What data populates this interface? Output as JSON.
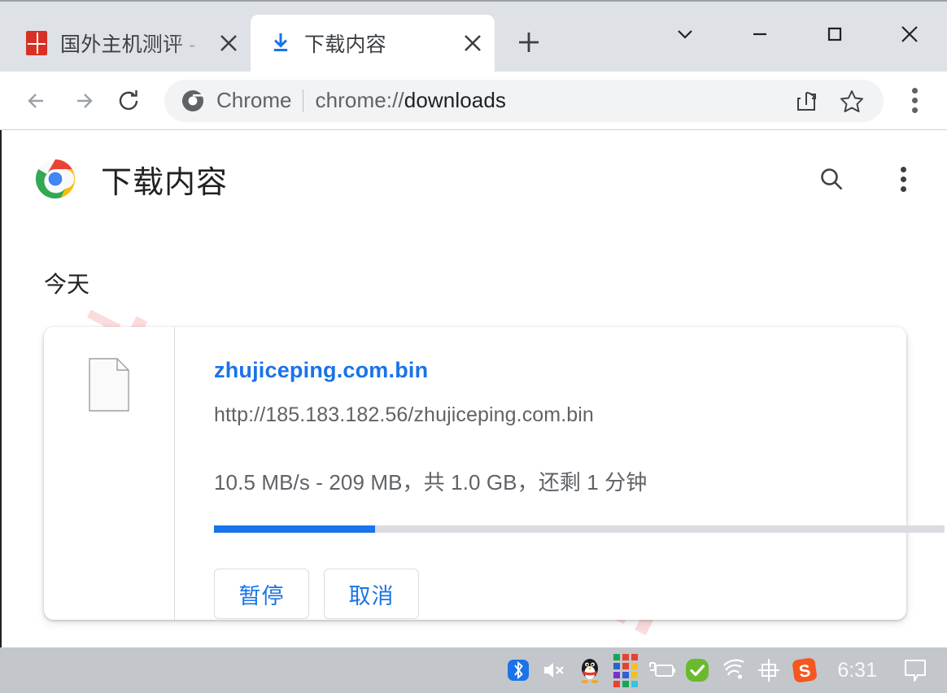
{
  "browser": {
    "tabs": [
      {
        "title": "国外主机测评 - 国",
        "favicon": "red-seal-icon",
        "active": false,
        "close_label": "✕"
      },
      {
        "title": "下载内容",
        "favicon": "download-icon",
        "active": true,
        "close_label": "✕"
      }
    ],
    "new_tab_label": "+",
    "window_controls": {
      "tab_search": "tab-search-chevron-icon",
      "minimize": "minimize-icon",
      "maximize": "maximize-icon",
      "close": "close-icon"
    },
    "toolbar": {
      "back": "back-arrow-icon",
      "forward": "forward-arrow-icon",
      "reload": "reload-icon",
      "omnibox": {
        "chrome_label": "Chrome",
        "url_scheme": "chrome://",
        "url_rest": "downloads",
        "full_url": "chrome://downloads",
        "share_icon": "share-icon",
        "bookmark_icon": "star-icon"
      },
      "menu": "three-dot-menu-icon"
    }
  },
  "page": {
    "watermark": "zhujiceping.com",
    "logo": "chrome-logo",
    "title": "下载内容",
    "search_icon": "search-icon",
    "menu_icon": "three-dot-menu-icon",
    "section_label": "今天",
    "download": {
      "file_icon": "generic-file-icon",
      "file_name": "zhujiceping.com.bin",
      "file_url": "http://185.183.182.56/zhujiceping.com.bin",
      "status": "10.5 MB/s - 209 MB，共 1.0 GB，还剩 1 分钟",
      "progress_percent": 22,
      "pause_label": "暂停",
      "cancel_label": "取消"
    }
  },
  "taskbar": {
    "icons": [
      "bluetooth-icon",
      "speaker-muted-icon",
      "qq-penguin-icon",
      "color-grid-icon",
      "battery-charging-icon",
      "security-check-icon",
      "wifi-icon",
      "ime-chinese-icon",
      "sogou-ime-icon"
    ],
    "time": "6:31",
    "notification_icon": "notification-balloon-icon"
  },
  "colors": {
    "accent_blue": "#1a73e8",
    "tabstrip": "#dee1e6",
    "taskbar": "#c3c7cb",
    "watermark_pink": "#fbdcdc",
    "progress_track": "#dadce0"
  }
}
